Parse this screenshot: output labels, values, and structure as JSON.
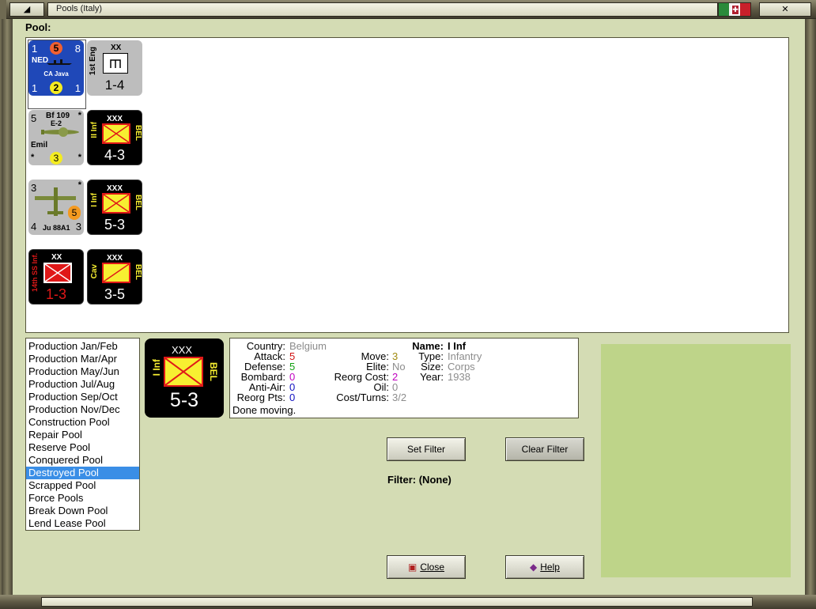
{
  "window": {
    "title": "Pools (Italy)",
    "close_glyph": "✕",
    "left_glyph": "◢"
  },
  "pool": {
    "label": "Pool:",
    "counters": [
      {
        "id": "ca-java",
        "nation": "NED",
        "top_left": "1",
        "top_mid": "5",
        "top_right": "8",
        "name": "CA Java",
        "bottom_left": "1",
        "bottom_mid": "2",
        "bottom_right": "1"
      },
      {
        "id": "1st-eng",
        "size": "XX",
        "name": "1st Eng",
        "strength": "1-4"
      },
      {
        "id": "bf109",
        "top_left": "5",
        "model": "Bf 109",
        "variant": "E-2",
        "top_right": "*",
        "nickname": "Emil",
        "bottom_left": "*",
        "bottom_mid": "3",
        "bottom_right": "*"
      },
      {
        "id": "ii-inf",
        "size": "XXX",
        "name": "II Inf",
        "nation": "BEL",
        "strength": "4-3"
      },
      {
        "id": "ju88",
        "top_left": "3",
        "top_right": "*",
        "mid_right": "5",
        "bottom_left": "4",
        "model": "Ju 88A1",
        "bottom_right": "3"
      },
      {
        "id": "i-inf",
        "size": "XXX",
        "name": "I Inf",
        "nation": "BEL",
        "strength": "5-3"
      },
      {
        "id": "14th-ss",
        "size": "XX",
        "name": "14th SS Inf.",
        "strength": "1-3"
      },
      {
        "id": "cav",
        "size": "XXX",
        "name": "Cav",
        "nation": "BEL",
        "strength": "3-5"
      }
    ]
  },
  "pool_list": {
    "items": [
      "Production Jan/Feb",
      "Production Mar/Apr",
      "Production May/Jun",
      "Production Jul/Aug",
      "Production Sep/Oct",
      "Production Nov/Dec",
      "Construction Pool",
      "Repair Pool",
      "Reserve Pool",
      "Conquered Pool",
      "Destroyed Pool",
      "Scrapped Pool",
      "Force Pools",
      "Break Down Pool",
      "Lend Lease Pool"
    ],
    "selected": "Destroyed Pool"
  },
  "selected_unit": {
    "counter": {
      "size": "XXX",
      "name": "I Inf",
      "nation": "BEL",
      "strength": "5-3"
    },
    "country_label": "Country:",
    "country": "Belgium",
    "attack_label": "Attack:",
    "attack": "5",
    "defense_label": "Defense:",
    "defense": "5",
    "bombard_label": "Bombard:",
    "bombard": "0",
    "antiair_label": "Anti-Air:",
    "antiair": "0",
    "reorg_pts_label": "Reorg Pts:",
    "reorg_pts": "0",
    "move_label": "Move:",
    "move": "3",
    "elite_label": "Elite:",
    "elite": "No",
    "reorg_cost_label": "Reorg Cost:",
    "reorg_cost": "2",
    "oil_label": "Oil:",
    "oil": "0",
    "cost_turns_label": "Cost/Turns:",
    "cost_turns": "3/2",
    "name_label": "Name:",
    "name": "I Inf",
    "type_label": "Type:",
    "type": "Infantry",
    "size_label": "Size:",
    "size": "Corps",
    "year_label": "Year:",
    "year": "1938",
    "status": "Done moving."
  },
  "buttons": {
    "set_filter": "Set Filter",
    "clear_filter": "Clear Filter",
    "close": "Close",
    "help": "Help"
  },
  "filter": {
    "label": "Filter: (None)"
  },
  "colors": {
    "accent": "#3a8ee6",
    "panel": "#bed489",
    "window_bg": "#d4dcb4"
  }
}
